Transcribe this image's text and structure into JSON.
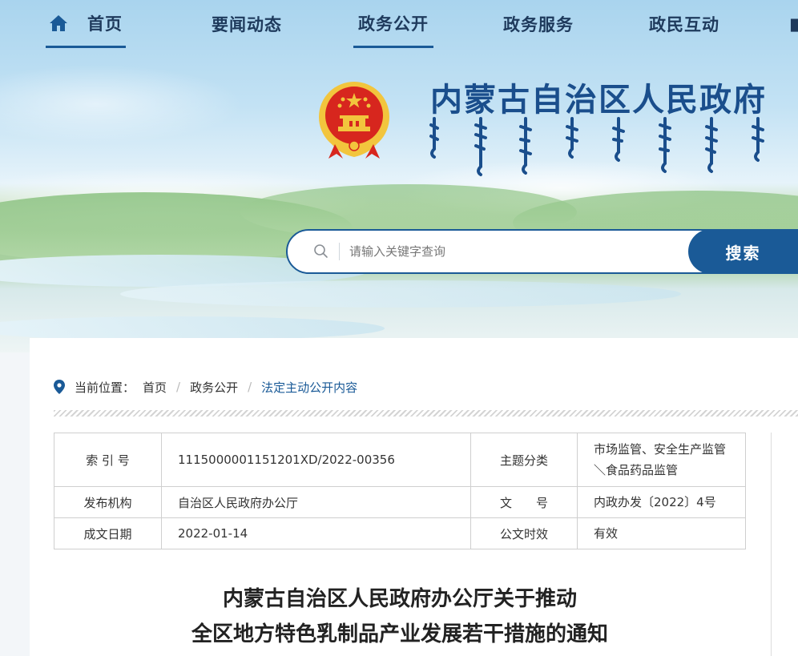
{
  "nav": {
    "items": [
      {
        "label": "首页"
      },
      {
        "label": "要闻动态"
      },
      {
        "label": "政务公开"
      },
      {
        "label": "政务服务"
      },
      {
        "label": "政民互动"
      }
    ]
  },
  "header": {
    "site_title": "内蒙古自治区人民政府"
  },
  "search": {
    "placeholder": "请输入关键字查询",
    "button_label": "搜索"
  },
  "breadcrumb": {
    "prefix": "当前位置：",
    "items": [
      "首页",
      "政务公开",
      "法定主动公开内容"
    ]
  },
  "meta": {
    "index_label": "索 引 号",
    "index_value": "1115000001151201XD/2022-00356",
    "topic_label": "主题分类",
    "topic_value": "市场监管、安全生产监管＼食品药品监管",
    "issuer_label": "发布机构",
    "issuer_value": "自治区人民政府办公厅",
    "docno_label": "文　　号",
    "docno_value": "内政办发〔2022〕4号",
    "date_label": "成文日期",
    "date_value": "2022-01-14",
    "validity_label": "公文时效",
    "validity_value": "有效"
  },
  "document": {
    "title_line1": "内蒙古自治区人民政府办公厅关于推动",
    "title_line2": "全区地方特色乳制品产业发展若干措施的通知"
  },
  "colors": {
    "primary": "#1a5a97",
    "title_blue": "#1a4e8c",
    "nav_text": "#1e3a5c",
    "emblem_red": "#d7261e",
    "emblem_gold": "#f2c53d"
  }
}
